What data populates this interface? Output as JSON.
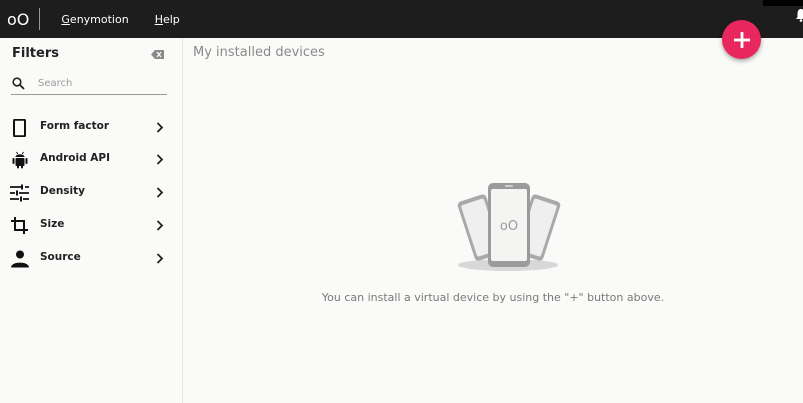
{
  "app": {
    "logo_text": "oO",
    "menu": [
      {
        "underline": "G",
        "rest": "enymotion"
      },
      {
        "underline": "H",
        "rest": "elp"
      }
    ]
  },
  "sidebar": {
    "title": "Filters",
    "search_placeholder": "Search",
    "items": [
      {
        "label": "Form factor",
        "icon": "phone-icon"
      },
      {
        "label": "Android API",
        "icon": "android-icon"
      },
      {
        "label": "Density",
        "icon": "sliders-icon"
      },
      {
        "label": "Size",
        "icon": "crop-icon"
      },
      {
        "label": "Source",
        "icon": "person-icon"
      }
    ]
  },
  "main": {
    "title": "My installed devices",
    "empty_message": "You can install a virtual device by using the \"+\" button above.",
    "illustration_text": "oO"
  },
  "colors": {
    "menubar": "#1d1d1d",
    "fab": "#e8275e",
    "background": "#fafaf9"
  }
}
